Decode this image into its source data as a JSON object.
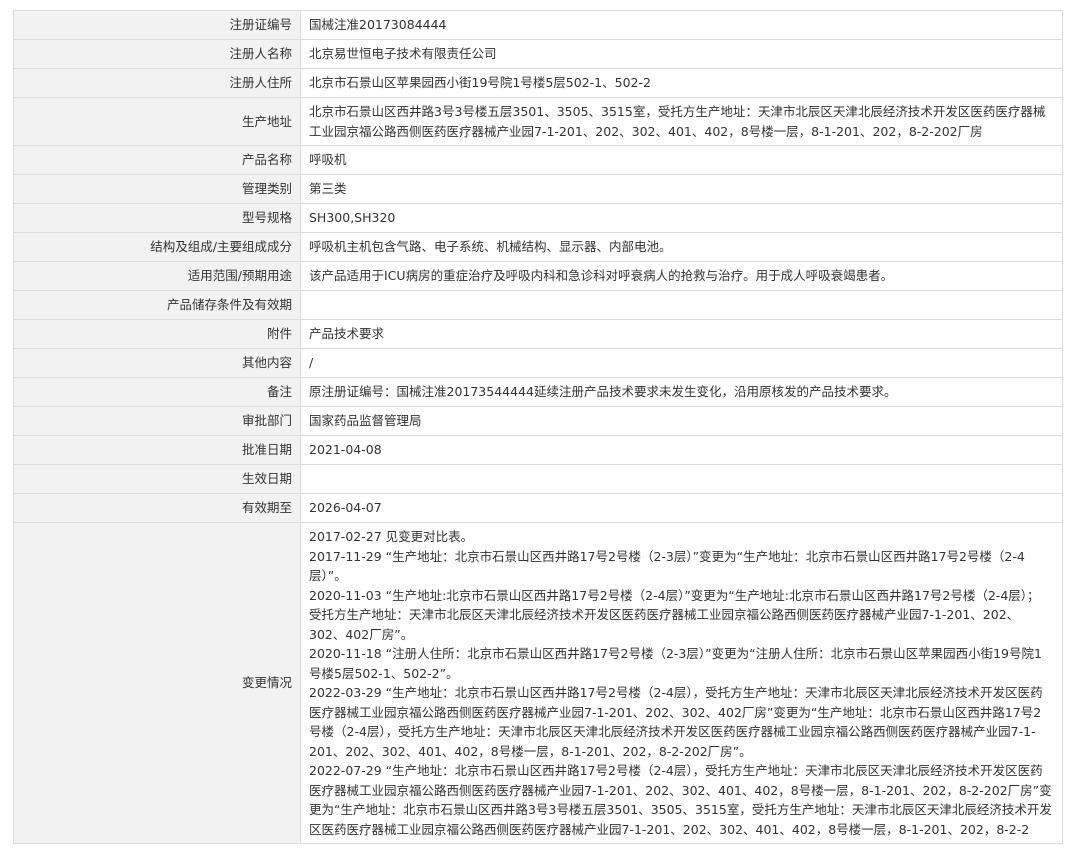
{
  "rows": [
    {
      "label": "注册证编号",
      "value": "国械注准20173084444"
    },
    {
      "label": "注册人名称",
      "value": "北京易世恒电子技术有限责任公司"
    },
    {
      "label": "注册人住所",
      "value": "北京市石景山区苹果园西小街19号院1号楼5层502-1、502-2"
    },
    {
      "label": "生产地址",
      "value": "北京市石景山区西井路3号3号楼五层3501、3505、3515室，受托方生产地址：天津市北辰区天津北辰经济技术开发区医药医疗器械工业园京福公路西侧医药医疗器械产业园7-1-201、202、302、401、402，8号楼一层，8-1-201、202，8-2-202厂房"
    },
    {
      "label": "产品名称",
      "value": "呼吸机"
    },
    {
      "label": "管理类别",
      "value": "第三类"
    },
    {
      "label": "型号规格",
      "value": "SH300,SH320"
    },
    {
      "label": "结构及组成/主要组成成分",
      "value": "呼吸机主机包含气路、电子系统、机械结构、显示器、内部电池。"
    },
    {
      "label": "适用范围/预期用途",
      "value": "该产品适用于ICU病房的重症治疗及呼吸内科和急诊科对呼衰病人的抢救与治疗。用于成人呼吸衰竭患者。"
    },
    {
      "label": "产品储存条件及有效期",
      "value": ""
    },
    {
      "label": "附件",
      "value": "产品技术要求"
    },
    {
      "label": "其他内容",
      "value": "/"
    },
    {
      "label": "备注",
      "value": "原注册证编号：国械注准20173544444延续注册产品技术要求未发生变化，沿用原核发的产品技术要求。"
    },
    {
      "label": "审批部门",
      "value": "国家药品监督管理局"
    },
    {
      "label": "批准日期",
      "value": "2021-04-08"
    },
    {
      "label": "生效日期",
      "value": ""
    },
    {
      "label": "有效期至",
      "value": "2026-04-07"
    }
  ],
  "changes": {
    "label": "变更情况",
    "entries": [
      "2017-02-27 见变更对比表。",
      "2017-11-29 “生产地址：北京市石景山区西井路17号2号楼（2-3层）”变更为“生产地址：北京市石景山区西井路17号2号楼（2-4层）”。",
      "2020-11-03 “生产地址:北京市石景山区西井路17号2号楼（2-4层）”变更为“生产地址:北京市石景山区西井路17号2号楼（2-4层）；受托方生产地址：天津市北辰区天津北辰经济技术开发区医药医疗器械工业园京福公路西侧医药医疗器械产业园7-1-201、202、302、402厂房”。",
      "2020-11-18 “注册人住所：北京市石景山区西井路17号2号楼（2-3层）”变更为“注册人住所：北京市石景山区苹果园西小街19号院1号楼5层502-1、502-2”。",
      "2022-03-29 “生产地址：北京市石景山区西井路17号2号楼（2-4层），受托方生产地址：天津市北辰区天津北辰经济技术开发区医药医疗器械工业园京福公路西侧医药医疗器械产业园7-1-201、202、302、402厂房”变更为“生产地址：北京市石景山区西井路17号2号楼（2-4层），受托方生产地址：天津市北辰区天津北辰经济技术开发区医药医疗器械工业园京福公路西侧医药医疗器械产业园7-1-201、202、302、401、402，8号楼一层，8-1-201、202，8-2-202厂房”。",
      "2022-07-29 “生产地址：北京市石景山区西井路17号2号楼（2-4层），受托方生产地址：天津市北辰区天津北辰经济技术开发区医药医疗器械工业园京福公路西侧医药医疗器械产业园7-1-201、202、302、401、402，8号楼一层，8-1-201、202，8-2-202厂房”变更为“生产地址：北京市石景山区西井路3号3号楼五层3501、3505、3515室，受托方生产地址：天津市北辰区天津北辰经济技术开发区医药医疗器械工业园京福公路西侧医药医疗器械产业园7-1-201、202、302、401、402，8号楼一层，8-1-201、202，8-2-2"
    ]
  }
}
